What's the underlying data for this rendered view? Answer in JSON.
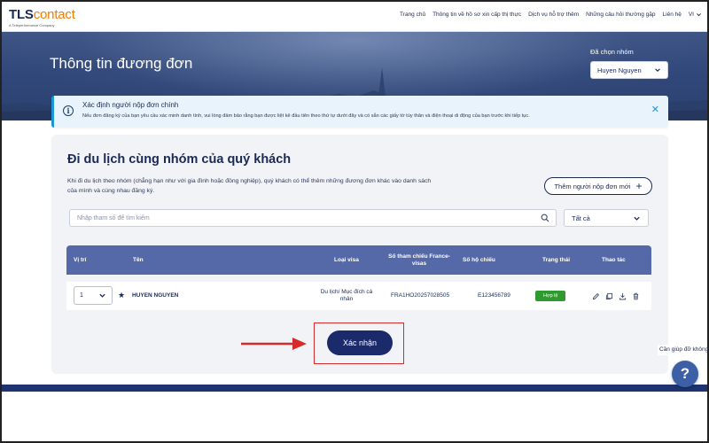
{
  "nav": {
    "logo_brand": "TLS",
    "logo_suffix": "contact",
    "logo_tagline": "A Teleperformance Company",
    "links": [
      "Trang chủ",
      "Thông tin về hồ sơ xin cấp thị thực",
      "Dịch vụ hỗ trợ thêm",
      "Những câu hỏi thường gặp",
      "Liên hệ"
    ],
    "language": "VI"
  },
  "hero": {
    "title": "Thông tin đương đơn",
    "group_label": "Đã chọn nhóm",
    "group_value": "Huyen Nguyen"
  },
  "info": {
    "title": "Xác định người nộp đơn chính",
    "text": "Nếu đơn đăng ký của bạn yêu cầu xác minh danh tính, vui lòng đảm bảo rằng bạn được liệt kê đầu tiên theo thứ tự dưới đây và có sẵn các giấy tờ tùy thân và điện thoại di động của bạn trước khi tiếp tục."
  },
  "main": {
    "title": "Đi du lịch cùng nhóm của quý khách",
    "description": "Khi đi du lịch theo nhóm (chẳng hạn như với gia đình hoặc đồng nghiệp), quý khách có thể thêm những đương đơn khác vào danh sách của mình và cùng nhau đăng ký.",
    "add_button": "Thêm người nộp đơn mới",
    "search_placeholder": "Nhập tham số để tìm kiếm",
    "filter_value": "Tất cả",
    "confirm_button": "Xác nhận"
  },
  "table": {
    "headers": {
      "position": "Vị trí",
      "name": "Tên",
      "visa_type": "Loại visa",
      "france_visas_ref": "Số tham chiếu France-visas",
      "passport": "Số hộ chiếu",
      "status": "Trạng thái",
      "actions": "Thao tác"
    },
    "rows": [
      {
        "position": "1",
        "name": "HUYEN NGUYEN",
        "visa_type": "Du lịch/ Mục đích cá nhân",
        "france_visas_ref": "FRA1HO20257028505",
        "passport": "E123456789",
        "status": "Hợp lệ"
      }
    ]
  },
  "help": {
    "text": "Cần giúp đỡ không",
    "icon_label": "?"
  },
  "colors": {
    "primary": "#1b2a55",
    "table_header": "#5569a8",
    "accent_orange": "#f07d00",
    "status_green": "#2f9a2f",
    "annotation_red": "#d62b2b"
  }
}
